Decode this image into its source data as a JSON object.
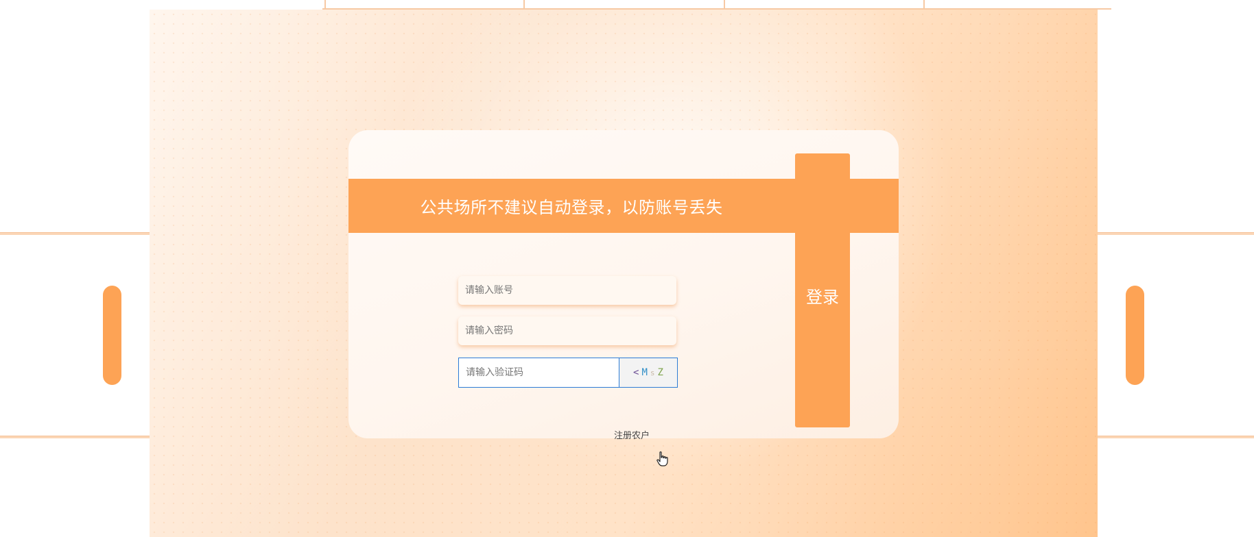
{
  "banner": {
    "text": "公共场所不建议自动登录，以防账号丢失"
  },
  "form": {
    "account_placeholder": "请输入账号",
    "password_placeholder": "请输入密码",
    "captcha_placeholder": "请输入验证码",
    "captcha_chars": [
      "<",
      "M",
      "s",
      "Z"
    ]
  },
  "login_button": {
    "label": "登录"
  },
  "register_link": {
    "label": "注册农户"
  },
  "colors": {
    "accent": "#fda355",
    "captcha_border": "#2b7bd6"
  },
  "icons": [
    "hand-pointer-icon"
  ]
}
